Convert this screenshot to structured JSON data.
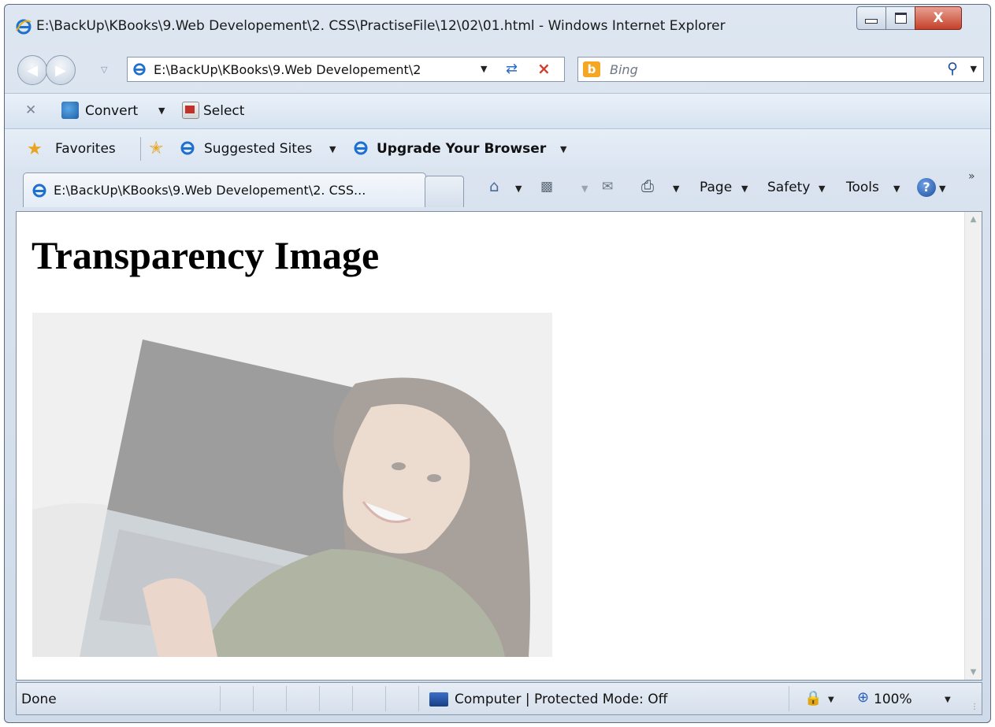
{
  "window": {
    "title": "E:\\BackUp\\KBooks\\9.Web Developement\\2. CSS\\PractiseFile\\12\\02\\01.html - Windows Internet Explorer",
    "close_label": "X"
  },
  "address_bar": {
    "url": "E:\\BackUp\\KBooks\\9.Web Developement\\2",
    "search_placeholder": "Bing"
  },
  "convert_toolbar": {
    "convert_label": "Convert",
    "select_label": "Select"
  },
  "favorites_bar": {
    "favorites_label": "Favorites",
    "suggested_sites_label": "Suggested Sites",
    "upgrade_label": "Upgrade Your Browser"
  },
  "tab": {
    "title": "E:\\BackUp\\KBooks\\9.Web Developement\\2. CSS..."
  },
  "command_bar": {
    "page_label": "Page",
    "safety_label": "Safety",
    "tools_label": "Tools",
    "help_glyph": "?"
  },
  "page": {
    "heading": "Transparency Image",
    "image_opacity": 0.4
  },
  "status_bar": {
    "status": "Done",
    "zone": "Computer | Protected Mode: Off",
    "zoom": "100%"
  },
  "icons": {
    "browser": "ie-icon",
    "search": "magnifier-icon",
    "refresh": "refresh-icon",
    "stop": "stop-icon",
    "home": "home-icon",
    "feeds": "feeds-icon",
    "mail": "mail-icon",
    "print": "print-icon",
    "help": "help-icon"
  },
  "colors": {
    "chrome": "#dde6f1",
    "close_button": "#c4412a",
    "ie_blue": "#1d6fd0"
  }
}
